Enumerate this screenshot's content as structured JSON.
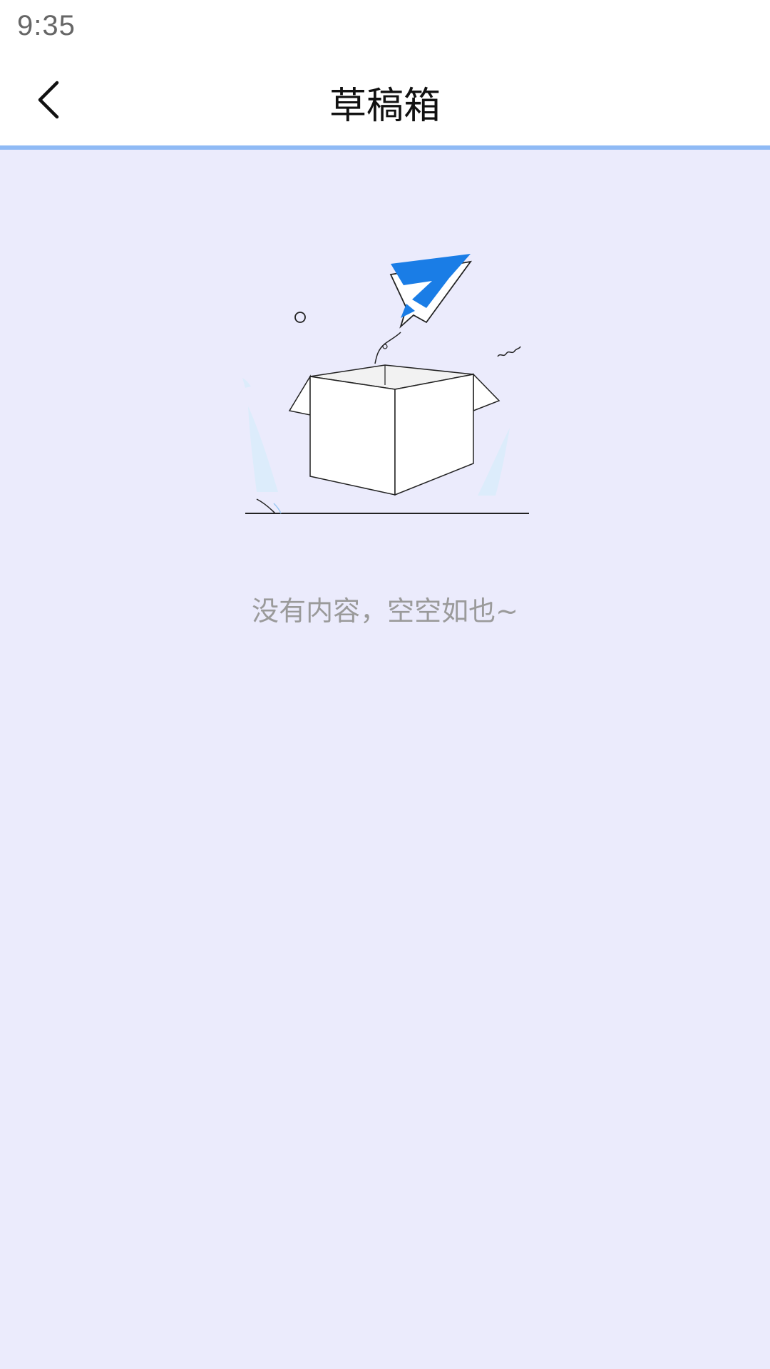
{
  "status_bar": {
    "time": "9:35"
  },
  "header": {
    "title": "草稿箱",
    "back_icon": "chevron-left-icon"
  },
  "empty_state": {
    "illustration": "empty-box-paper-plane-illustration",
    "message": "没有内容，空空如也~"
  },
  "colors": {
    "background": "#ebebfc",
    "header_divider": "#8fbaf5",
    "plane_blue": "#1a7de6"
  }
}
